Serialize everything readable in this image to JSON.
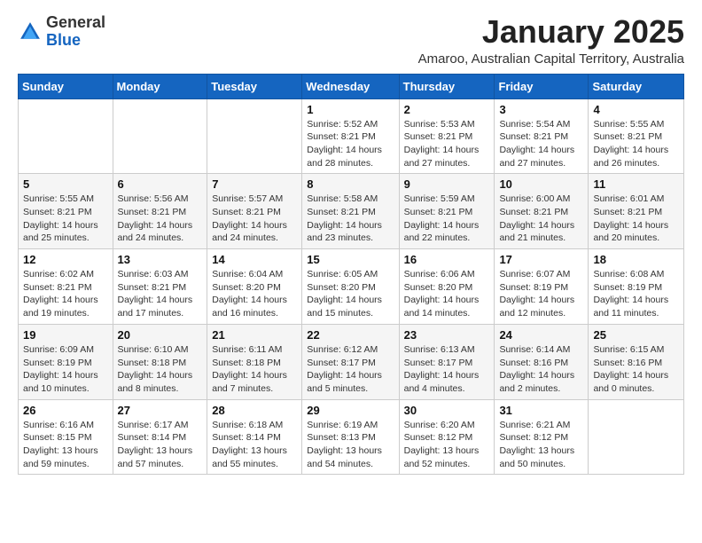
{
  "logo": {
    "general": "General",
    "blue": "Blue"
  },
  "header": {
    "title": "January 2025",
    "subtitle": "Amaroo, Australian Capital Territory, Australia"
  },
  "days_of_week": [
    "Sunday",
    "Monday",
    "Tuesday",
    "Wednesday",
    "Thursday",
    "Friday",
    "Saturday"
  ],
  "weeks": [
    [
      {
        "day": "",
        "info": ""
      },
      {
        "day": "",
        "info": ""
      },
      {
        "day": "",
        "info": ""
      },
      {
        "day": "1",
        "info": "Sunrise: 5:52 AM\nSunset: 8:21 PM\nDaylight: 14 hours\nand 28 minutes."
      },
      {
        "day": "2",
        "info": "Sunrise: 5:53 AM\nSunset: 8:21 PM\nDaylight: 14 hours\nand 27 minutes."
      },
      {
        "day": "3",
        "info": "Sunrise: 5:54 AM\nSunset: 8:21 PM\nDaylight: 14 hours\nand 27 minutes."
      },
      {
        "day": "4",
        "info": "Sunrise: 5:55 AM\nSunset: 8:21 PM\nDaylight: 14 hours\nand 26 minutes."
      }
    ],
    [
      {
        "day": "5",
        "info": "Sunrise: 5:55 AM\nSunset: 8:21 PM\nDaylight: 14 hours\nand 25 minutes."
      },
      {
        "day": "6",
        "info": "Sunrise: 5:56 AM\nSunset: 8:21 PM\nDaylight: 14 hours\nand 24 minutes."
      },
      {
        "day": "7",
        "info": "Sunrise: 5:57 AM\nSunset: 8:21 PM\nDaylight: 14 hours\nand 24 minutes."
      },
      {
        "day": "8",
        "info": "Sunrise: 5:58 AM\nSunset: 8:21 PM\nDaylight: 14 hours\nand 23 minutes."
      },
      {
        "day": "9",
        "info": "Sunrise: 5:59 AM\nSunset: 8:21 PM\nDaylight: 14 hours\nand 22 minutes."
      },
      {
        "day": "10",
        "info": "Sunrise: 6:00 AM\nSunset: 8:21 PM\nDaylight: 14 hours\nand 21 minutes."
      },
      {
        "day": "11",
        "info": "Sunrise: 6:01 AM\nSunset: 8:21 PM\nDaylight: 14 hours\nand 20 minutes."
      }
    ],
    [
      {
        "day": "12",
        "info": "Sunrise: 6:02 AM\nSunset: 8:21 PM\nDaylight: 14 hours\nand 19 minutes."
      },
      {
        "day": "13",
        "info": "Sunrise: 6:03 AM\nSunset: 8:21 PM\nDaylight: 14 hours\nand 17 minutes."
      },
      {
        "day": "14",
        "info": "Sunrise: 6:04 AM\nSunset: 8:20 PM\nDaylight: 14 hours\nand 16 minutes."
      },
      {
        "day": "15",
        "info": "Sunrise: 6:05 AM\nSunset: 8:20 PM\nDaylight: 14 hours\nand 15 minutes."
      },
      {
        "day": "16",
        "info": "Sunrise: 6:06 AM\nSunset: 8:20 PM\nDaylight: 14 hours\nand 14 minutes."
      },
      {
        "day": "17",
        "info": "Sunrise: 6:07 AM\nSunset: 8:19 PM\nDaylight: 14 hours\nand 12 minutes."
      },
      {
        "day": "18",
        "info": "Sunrise: 6:08 AM\nSunset: 8:19 PM\nDaylight: 14 hours\nand 11 minutes."
      }
    ],
    [
      {
        "day": "19",
        "info": "Sunrise: 6:09 AM\nSunset: 8:19 PM\nDaylight: 14 hours\nand 10 minutes."
      },
      {
        "day": "20",
        "info": "Sunrise: 6:10 AM\nSunset: 8:18 PM\nDaylight: 14 hours\nand 8 minutes."
      },
      {
        "day": "21",
        "info": "Sunrise: 6:11 AM\nSunset: 8:18 PM\nDaylight: 14 hours\nand 7 minutes."
      },
      {
        "day": "22",
        "info": "Sunrise: 6:12 AM\nSunset: 8:17 PM\nDaylight: 14 hours\nand 5 minutes."
      },
      {
        "day": "23",
        "info": "Sunrise: 6:13 AM\nSunset: 8:17 PM\nDaylight: 14 hours\nand 4 minutes."
      },
      {
        "day": "24",
        "info": "Sunrise: 6:14 AM\nSunset: 8:16 PM\nDaylight: 14 hours\nand 2 minutes."
      },
      {
        "day": "25",
        "info": "Sunrise: 6:15 AM\nSunset: 8:16 PM\nDaylight: 14 hours\nand 0 minutes."
      }
    ],
    [
      {
        "day": "26",
        "info": "Sunrise: 6:16 AM\nSunset: 8:15 PM\nDaylight: 13 hours\nand 59 minutes."
      },
      {
        "day": "27",
        "info": "Sunrise: 6:17 AM\nSunset: 8:14 PM\nDaylight: 13 hours\nand 57 minutes."
      },
      {
        "day": "28",
        "info": "Sunrise: 6:18 AM\nSunset: 8:14 PM\nDaylight: 13 hours\nand 55 minutes."
      },
      {
        "day": "29",
        "info": "Sunrise: 6:19 AM\nSunset: 8:13 PM\nDaylight: 13 hours\nand 54 minutes."
      },
      {
        "day": "30",
        "info": "Sunrise: 6:20 AM\nSunset: 8:12 PM\nDaylight: 13 hours\nand 52 minutes."
      },
      {
        "day": "31",
        "info": "Sunrise: 6:21 AM\nSunset: 8:12 PM\nDaylight: 13 hours\nand 50 minutes."
      },
      {
        "day": "",
        "info": ""
      }
    ]
  ]
}
